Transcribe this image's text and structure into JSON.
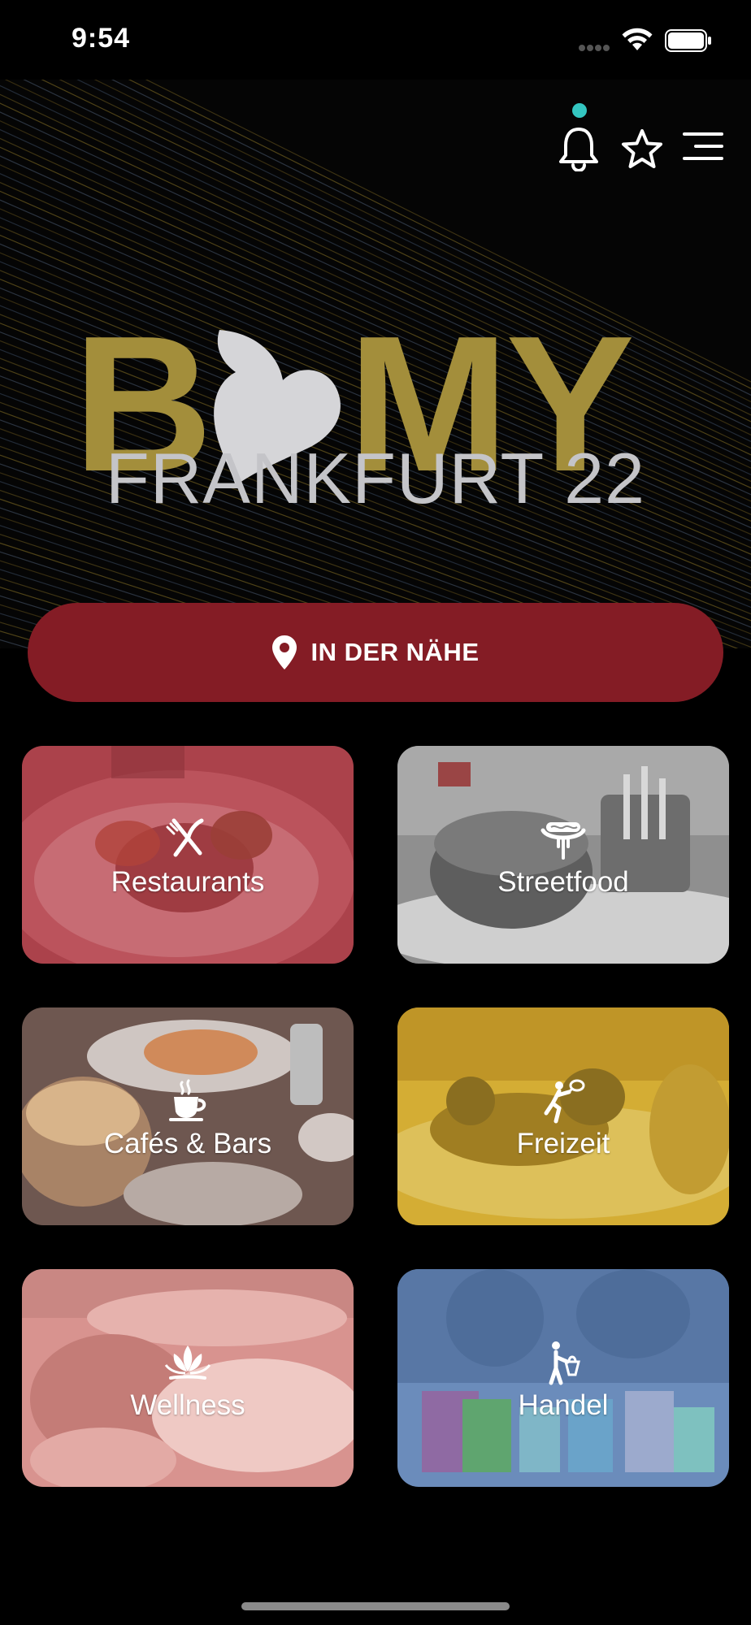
{
  "status_bar": {
    "time": "9:54"
  },
  "header": {
    "notification_indicator_color": "#34c6c1",
    "icons": [
      "bell-icon",
      "star-icon",
      "menu-icon"
    ]
  },
  "logo": {
    "text_left": "B",
    "text_right": "MY",
    "heart_color": "#d5d5d8",
    "text_color": "#a38e3b"
  },
  "city": {
    "title": "FRANKFURT 22"
  },
  "nearby_button": {
    "label": "IN DER NÄHE",
    "icon": "location-pin-icon",
    "color": "#841c25"
  },
  "categories": [
    {
      "label": "Restaurants",
      "icon": "fork-knife-icon",
      "tint": "#b3474f"
    },
    {
      "label": "Streetfood",
      "icon": "hotdog-icon",
      "tint": "#9a9a9a"
    },
    {
      "label": "Cafés & Bars",
      "icon": "coffee-cup-icon",
      "tint": "#7a6358"
    },
    {
      "label": "Freizeit",
      "icon": "tennis-player-icon",
      "tint": "#d6b13a"
    },
    {
      "label": "Wellness",
      "icon": "lotus-icon",
      "tint": "#d7908c"
    },
    {
      "label": "Handel",
      "icon": "shopper-icon",
      "tint": "#6d8fbe"
    }
  ]
}
